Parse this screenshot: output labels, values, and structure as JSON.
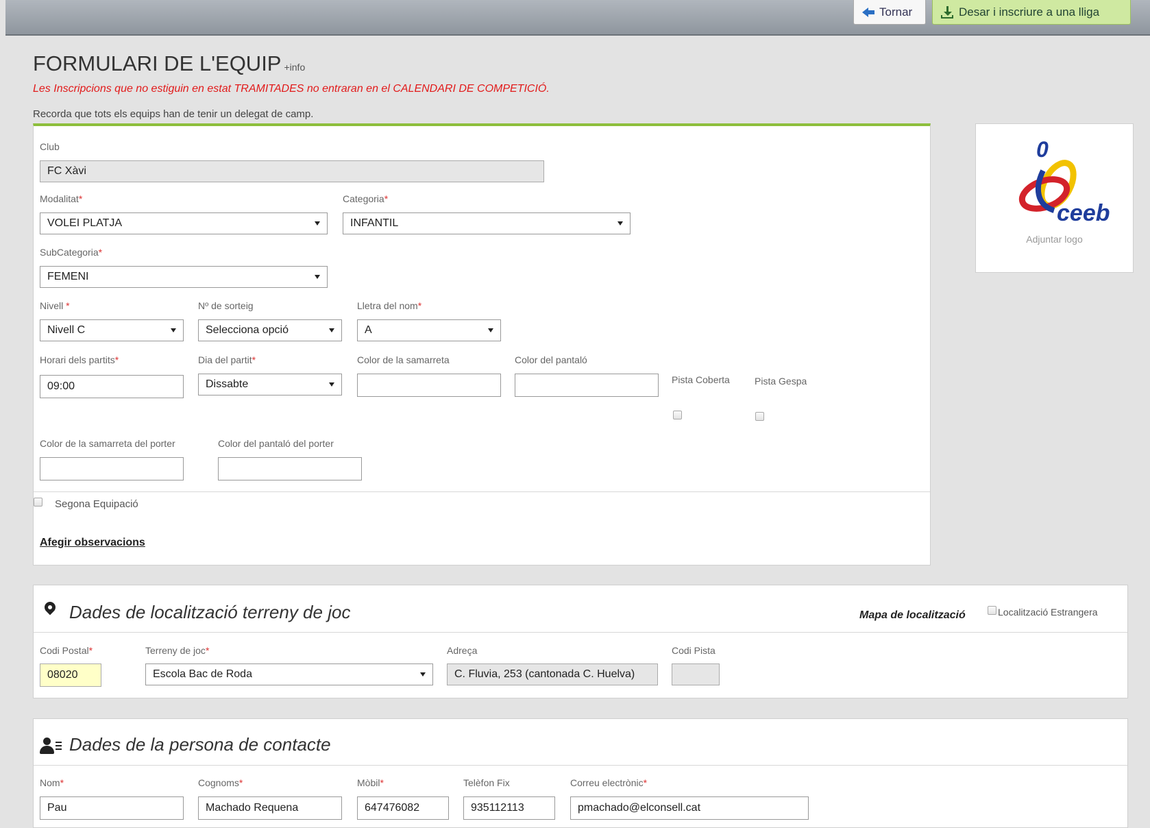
{
  "toolbar": {
    "back_label": "Tornar",
    "save_label": "Desar i inscriure a una lliga"
  },
  "header": {
    "title": "FORMULARI DE L'EQUIP",
    "info_link": "+info",
    "warning": "Les Inscripcions que no estiguin en estat TRAMITADES no entraran en el CALENDARI DE COMPETICIÓ.",
    "reminder": "Recorda que tots els equips han de tenir un delegat de camp."
  },
  "team": {
    "club": {
      "label": "Club",
      "value": "FC Xàvi"
    },
    "modalitat": {
      "label": "Modalitat",
      "value": "VOLEI PLATJA"
    },
    "categoria": {
      "label": "Categoria",
      "value": "INFANTIL"
    },
    "subcategoria": {
      "label": "SubCategoria",
      "value": "FEMENI"
    },
    "nivell": {
      "label": "Nivell ",
      "value": "Nivell C"
    },
    "sorteig": {
      "label": "Nº de sorteig",
      "value": "Selecciona opció"
    },
    "lletra": {
      "label": "Lletra del nom",
      "value": "A"
    },
    "horari": {
      "label": "Horari dels partits",
      "value": "09:00"
    },
    "dia": {
      "label": "Dia del partit",
      "value": "Dissabte"
    },
    "color_samarreta": {
      "label": "Color de la samarreta",
      "value": ""
    },
    "color_pantalo": {
      "label": "Color del pantaló",
      "value": ""
    },
    "pista_coberta": "Pista Coberta",
    "pista_gespa": "Pista Gespa",
    "color_samarreta_porter": {
      "label": "Color de la samarreta del porter",
      "value": ""
    },
    "color_pantalo_porter": {
      "label": "Color del pantaló del porter",
      "value": ""
    },
    "segona_equipacio": "Segona Equipació",
    "observacions_link": "Afegir observacions",
    "required_mark": "*"
  },
  "logo": {
    "caption": "Adjuntar logo",
    "brand": "ceeb",
    "colors": [
      "#f2c200",
      "#1f3d9c",
      "#d3222a"
    ]
  },
  "location": {
    "title": "Dades de localització terreny de joc",
    "map_label": "Mapa de localització",
    "foreign_label": "Localització Estrangera",
    "codi_postal": {
      "label": "Codi Postal",
      "value": "08020"
    },
    "terreny": {
      "label": "Terreny de joc",
      "value": "Escola Bac de Roda"
    },
    "adreca": {
      "label": "Adreça",
      "value": "C. Fluvia, 253 (cantonada C. Huelva)"
    },
    "codi_pista": {
      "label": "Codi Pista",
      "value": ""
    }
  },
  "contact": {
    "title": "Dades de la persona de contacte",
    "nom": {
      "label": "Nom",
      "value": "Pau"
    },
    "cognoms": {
      "label": "Cognoms",
      "value": "Machado Requena"
    },
    "mobil": {
      "label": "Mòbil",
      "value": "647476082"
    },
    "telefon": {
      "label": "Telèfon Fix",
      "value": "935112113"
    },
    "correu": {
      "label": "Correu electrònic",
      "value": "pmachado@elconsell.cat"
    }
  },
  "colors": {
    "accent_green": "#8dbf3c",
    "warning_red": "#e21b1b",
    "save_button_bg": "#cfe9a1"
  }
}
